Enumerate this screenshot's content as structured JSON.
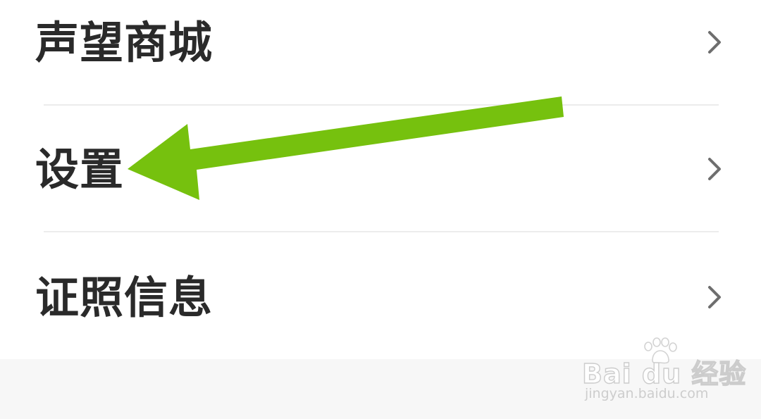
{
  "menu": {
    "items": [
      {
        "label": "声望商城"
      },
      {
        "label": "设置"
      },
      {
        "label": "证照信息"
      }
    ]
  },
  "annotation": {
    "arrow_color": "#76c10e",
    "arrow_target": "设置"
  },
  "watermark": {
    "brand": "Bai  du 经验",
    "url": "jingyan.baidu.com"
  },
  "colors": {
    "label": "#2a2a2a",
    "chevron": "#6e6e6e",
    "divider": "#ececec",
    "background": "#ffffff",
    "footer_bg": "#f7f7f7"
  },
  "icons": {
    "chevron": "chevron-right-icon",
    "arrow": "arrow-left-icon",
    "watermark_logo": "baidu-paw-icon"
  }
}
